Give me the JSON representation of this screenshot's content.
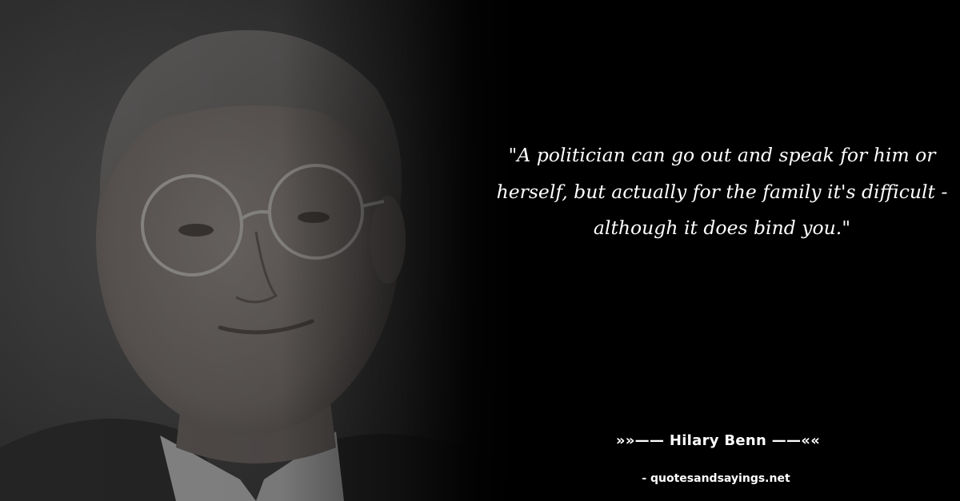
{
  "quote": {
    "text": "\"A politician can go out and speak for him or herself, but actually for the family it's difficult - although it does bind you.\""
  },
  "attribution": {
    "author_line": "»»—— Hilary Benn ——««"
  },
  "watermark": {
    "site": "- quotesandsayings.net"
  },
  "colors": {
    "background": "#000000",
    "text": "#ffffff"
  }
}
